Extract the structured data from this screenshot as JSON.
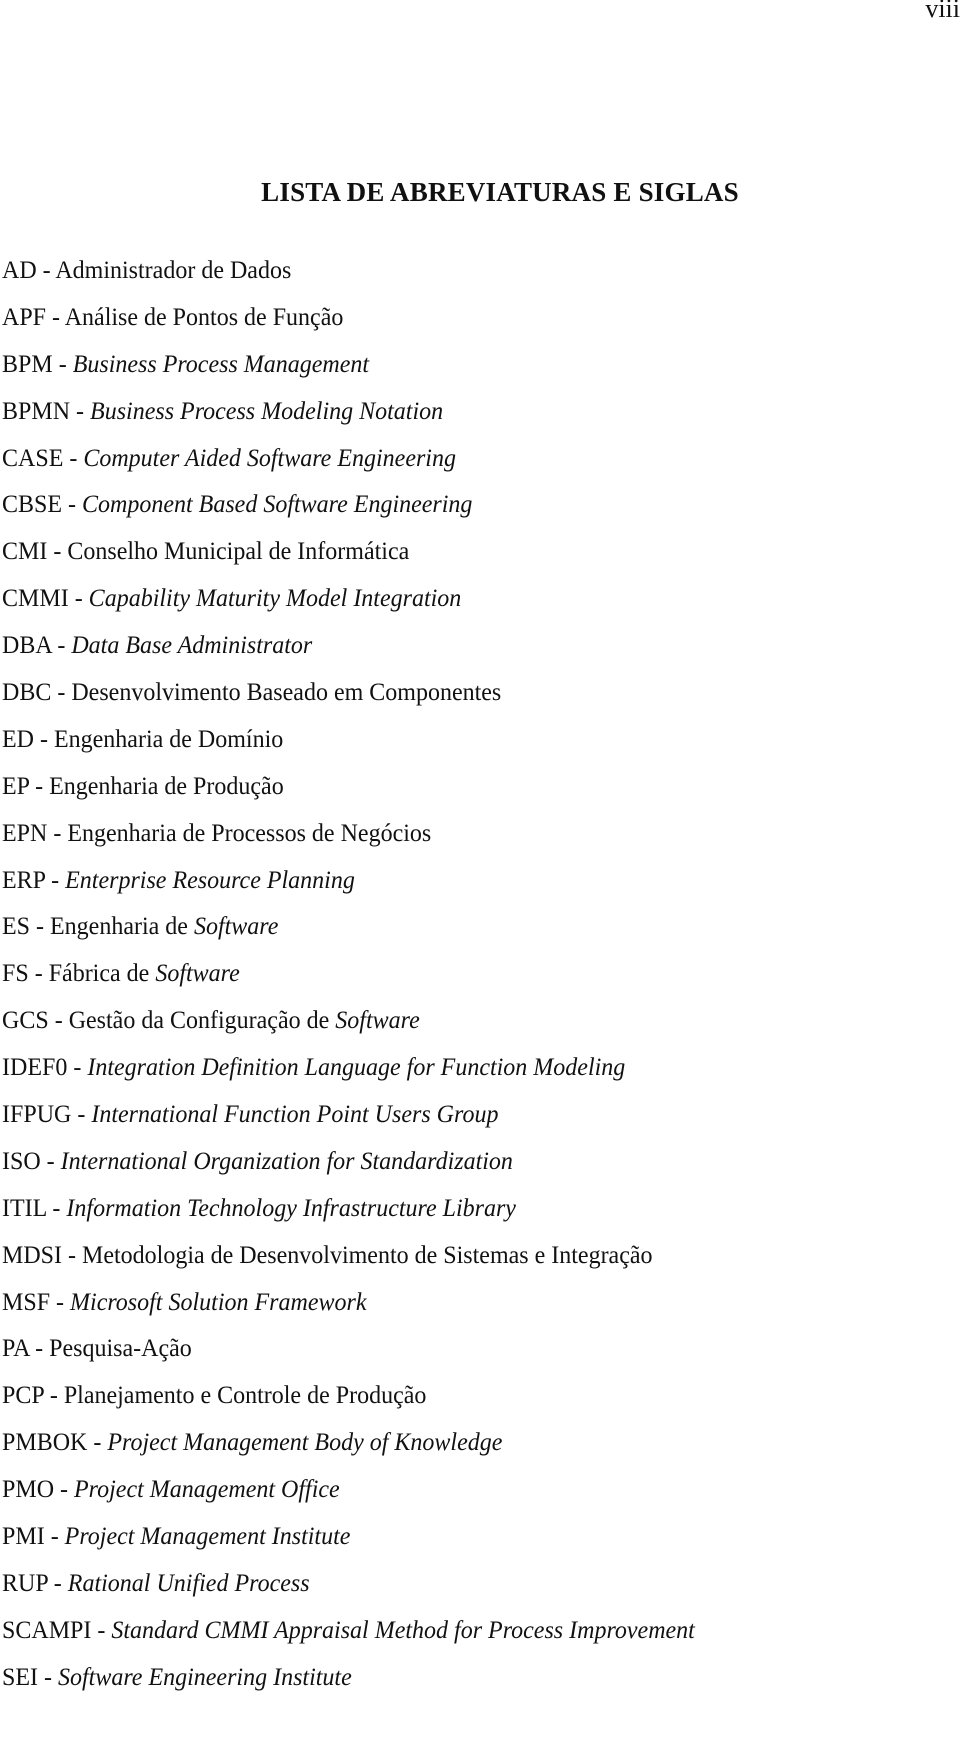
{
  "page": {
    "page_number": "viii",
    "title": "LISTA DE ABREVIATURAS E SIGLAS"
  },
  "entries": [
    {
      "acronym": "AD",
      "sep": " - ",
      "parts": [
        {
          "text": "Administrador de Dados",
          "italic": false
        }
      ]
    },
    {
      "acronym": "APF",
      "sep": " - ",
      "parts": [
        {
          "text": "Análise de Pontos de Função",
          "italic": false
        }
      ]
    },
    {
      "acronym": "BPM",
      "sep": " - ",
      "parts": [
        {
          "text": "Business Process Management",
          "italic": true
        }
      ]
    },
    {
      "acronym": "BPMN",
      "sep": " - ",
      "parts": [
        {
          "text": "Business Process Modeling Notation",
          "italic": true
        }
      ]
    },
    {
      "acronym": "CASE",
      "sep": " - ",
      "parts": [
        {
          "text": "Computer Aided Software Engineering",
          "italic": true
        }
      ]
    },
    {
      "acronym": "CBSE",
      "sep": " - ",
      "parts": [
        {
          "text": "Component Based Software Engineering",
          "italic": true
        }
      ]
    },
    {
      "acronym": "CMI",
      "sep": " - ",
      "parts": [
        {
          "text": "Conselho Municipal de Informática",
          "italic": false
        }
      ]
    },
    {
      "acronym": "CMMI",
      "sep": " - ",
      "parts": [
        {
          "text": "Capability Maturity Model Integration",
          "italic": true
        }
      ]
    },
    {
      "acronym": "DBA",
      "sep": " - ",
      "parts": [
        {
          "text": "Data Base Administrator",
          "italic": true
        }
      ]
    },
    {
      "acronym": "DBC",
      "sep": " - ",
      "parts": [
        {
          "text": "Desenvolvimento Baseado em Componentes",
          "italic": false
        }
      ]
    },
    {
      "acronym": "ED",
      "sep": " - ",
      "parts": [
        {
          "text": "Engenharia de Domínio",
          "italic": false
        }
      ]
    },
    {
      "acronym": "EP",
      "sep": " - ",
      "parts": [
        {
          "text": "Engenharia de Produção",
          "italic": false
        }
      ]
    },
    {
      "acronym": "EPN",
      "sep": " - ",
      "parts": [
        {
          "text": "Engenharia de Processos de Negócios",
          "italic": false
        }
      ]
    },
    {
      "acronym": "ERP",
      "sep": " - ",
      "parts": [
        {
          "text": "Enterprise Resource Planning",
          "italic": true
        }
      ]
    },
    {
      "acronym": "ES",
      "sep": " - ",
      "parts": [
        {
          "text": "Engenharia de ",
          "italic": false
        },
        {
          "text": "Software",
          "italic": true
        }
      ]
    },
    {
      "acronym": "FS",
      "sep": " - ",
      "parts": [
        {
          "text": "Fábrica de ",
          "italic": false
        },
        {
          "text": "Software",
          "italic": true
        }
      ]
    },
    {
      "acronym": "GCS",
      "sep": " - ",
      "parts": [
        {
          "text": "Gestão da Configuração de ",
          "italic": false
        },
        {
          "text": "Software",
          "italic": true
        }
      ]
    },
    {
      "acronym": "IDEF0",
      "sep": " - ",
      "parts": [
        {
          "text": "Integration Definition Language for Function Modeling",
          "italic": true
        }
      ]
    },
    {
      "acronym": "IFPUG",
      "sep": " - ",
      "parts": [
        {
          "text": "International Function Point Users Group",
          "italic": true
        }
      ]
    },
    {
      "acronym": "ISO",
      "sep": " - ",
      "parts": [
        {
          "text": "International Organization for Standardization",
          "italic": true
        }
      ]
    },
    {
      "acronym": "ITIL",
      "sep": " - ",
      "parts": [
        {
          "text": "Information Technology Infrastructure Library",
          "italic": true
        }
      ]
    },
    {
      "acronym": "MDSI",
      "sep": " - ",
      "parts": [
        {
          "text": "Metodologia de Desenvolvimento de Sistemas e Integração",
          "italic": false
        }
      ]
    },
    {
      "acronym": "MSF",
      "sep": " - ",
      "parts": [
        {
          "text": "Microsoft Solution Framework",
          "italic": true
        }
      ]
    },
    {
      "acronym": "PA",
      "sep": " - ",
      "parts": [
        {
          "text": "Pesquisa-Ação",
          "italic": false
        }
      ]
    },
    {
      "acronym": "PCP",
      "sep": " - ",
      "parts": [
        {
          "text": "Planejamento e Controle de Produção",
          "italic": false
        }
      ]
    },
    {
      "acronym": "PMBOK",
      "sep": " - ",
      "parts": [
        {
          "text": "Project Management Body of Knowledge",
          "italic": true
        }
      ]
    },
    {
      "acronym": "PMO",
      "sep": " - ",
      "parts": [
        {
          "text": "Project Management Office",
          "italic": true
        }
      ]
    },
    {
      "acronym": "PMI",
      "sep": " - ",
      "parts": [
        {
          "text": "Project Management Institute",
          "italic": true
        }
      ]
    },
    {
      "acronym": "RUP",
      "sep": " - ",
      "parts": [
        {
          "text": "Rational Unified Process",
          "italic": true
        }
      ]
    },
    {
      "acronym": "SCAMPI",
      "sep": " - ",
      "parts": [
        {
          "text": "Standard CMMI Appraisal Method for Process Improvement",
          "italic": true
        }
      ]
    },
    {
      "acronym": "SEI",
      "sep": " - ",
      "parts": [
        {
          "text": "Software Engineering Institute",
          "italic": true
        }
      ]
    }
  ]
}
